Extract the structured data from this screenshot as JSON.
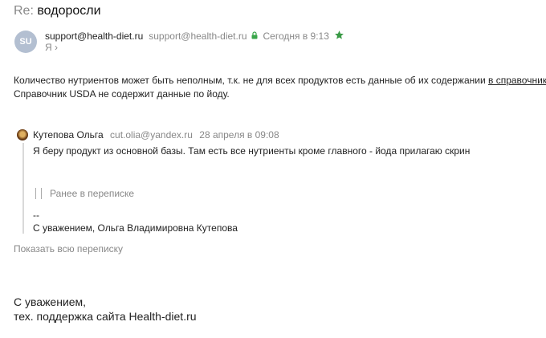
{
  "subject": {
    "prefix": "Re:",
    "text": "водоросли"
  },
  "sender": {
    "initials": "SU",
    "name": "support@health-diet.ru",
    "email": "support@health-diet.ru",
    "date": "Сегодня в 9:13",
    "recipient": "Я",
    "recipient_chevron": "›",
    "star_icon": "star-icon",
    "lock_icon": "lock-icon",
    "star_color": "#3a9a46",
    "lock_color": "#39a64a"
  },
  "message": {
    "line1_text": "Количество нутриентов может быть неполным, т.к. не для всех продуктов есть данные об их содержании ",
    "line1_link": "в справочниках",
    "line1_end": ".",
    "line2": "Справочник USDA не содержит данные по йоду."
  },
  "quote": {
    "author": "Кутепова Ольга",
    "email": "cut.olia@yandex.ru",
    "date": "28 апреля в 09:08",
    "text": "Я беру продукт из основной базы. Там есть все нутриенты кроме главного - йода прилагаю скрин",
    "earlier_label": "Ранее в переписке",
    "sig_dash": "--",
    "sig_text": "С уважением, Ольга Владимировна Кутепова"
  },
  "show_all_label": "Показать всю переписку",
  "closing": {
    "line1": "С уважением,",
    "line2": "тех. поддержка сайта Health-diet.ru"
  }
}
